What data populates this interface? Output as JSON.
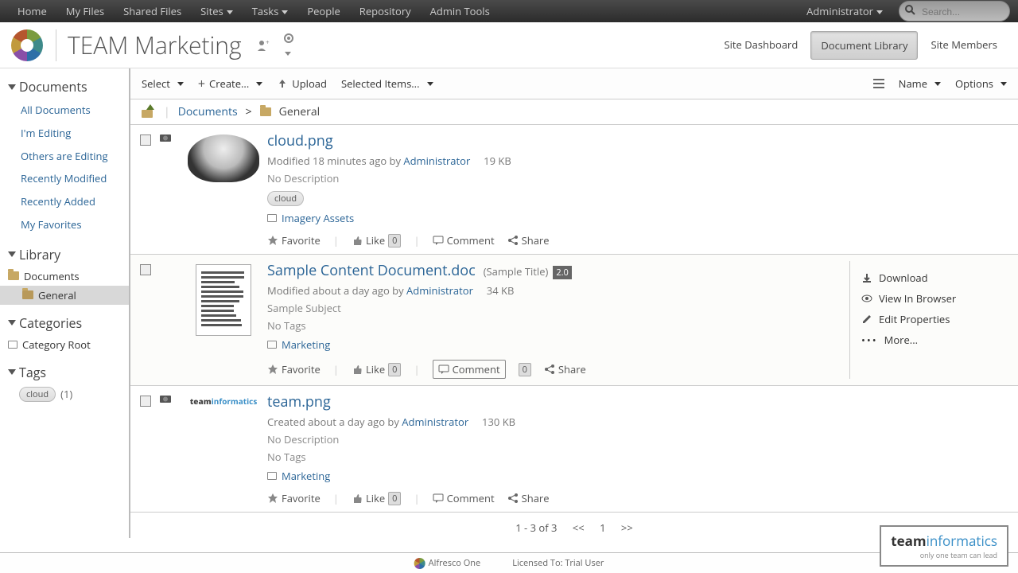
{
  "topnav": {
    "items": [
      "Home",
      "My Files",
      "Shared Files",
      "Sites",
      "Tasks",
      "People",
      "Repository",
      "Admin Tools"
    ],
    "dropdowns": [
      false,
      false,
      false,
      true,
      true,
      false,
      false,
      false
    ],
    "user": "Administrator",
    "search_placeholder": "Search..."
  },
  "site": {
    "title": "TEAM Marketing",
    "tabs": [
      "Site Dashboard",
      "Document Library",
      "Site Members"
    ],
    "active_tab": 1
  },
  "sidebar": {
    "documents_header": "Documents",
    "documents_items": [
      "All Documents",
      "I'm Editing",
      "Others are Editing",
      "Recently Modified",
      "Recently Added",
      "My Favorites"
    ],
    "library_header": "Library",
    "library_root": "Documents",
    "library_child": "General",
    "categories_header": "Categories",
    "categories_root": "Category Root",
    "tags_header": "Tags",
    "tags": [
      {
        "name": "cloud",
        "count": "(1)"
      }
    ]
  },
  "toolbar": {
    "select": "Select",
    "create": "Create...",
    "upload": "Upload",
    "selected": "Selected Items...",
    "sort": "Name",
    "options": "Options"
  },
  "breadcrumb": {
    "root": "Documents",
    "sep": ">",
    "current": "General"
  },
  "docs": [
    {
      "title": "cloud.png",
      "subtitle": "",
      "version": "",
      "meta_prefix": "Modified 18 minutes ago by",
      "meta_user": "Administrator",
      "size": "19 KB",
      "description": "No Description",
      "tags": [
        "cloud"
      ],
      "no_tags": "",
      "category": "Imagery Assets",
      "has_camera": true,
      "thumb_type": "cloud"
    },
    {
      "title": "Sample Content Document.doc",
      "subtitle": "(Sample Title)",
      "version": "2.0",
      "meta_prefix": "Modified about a day ago by",
      "meta_user": "Administrator",
      "size": "34 KB",
      "description": "Sample Subject",
      "tags": [],
      "no_tags": "No Tags",
      "category": "Marketing",
      "has_camera": false,
      "thumb_type": "doc",
      "hover": true
    },
    {
      "title": "team.png",
      "subtitle": "",
      "version": "",
      "meta_prefix": "Created about a day ago by",
      "meta_user": "Administrator",
      "size": "130 KB",
      "description": "No Description",
      "tags": [],
      "no_tags": "No Tags",
      "category": "Marketing",
      "has_camera": true,
      "thumb_type": "team"
    }
  ],
  "row_actions": {
    "favorite": "Favorite",
    "like": "Like",
    "like_count": "0",
    "comment": "Comment",
    "comment_count": "0",
    "share": "Share"
  },
  "side_actions": {
    "download": "Download",
    "view": "View In Browser",
    "edit": "Edit Properties",
    "more": "More..."
  },
  "pagination": {
    "range": "1 - 3 of 3",
    "prev": "<<",
    "page": "1",
    "next": ">>"
  },
  "footer": {
    "product": "Alfresco One",
    "license": "Licensed To: Trial User",
    "brand": "team",
    "brand2": "informatics",
    "tagline": "only one team can lead"
  }
}
